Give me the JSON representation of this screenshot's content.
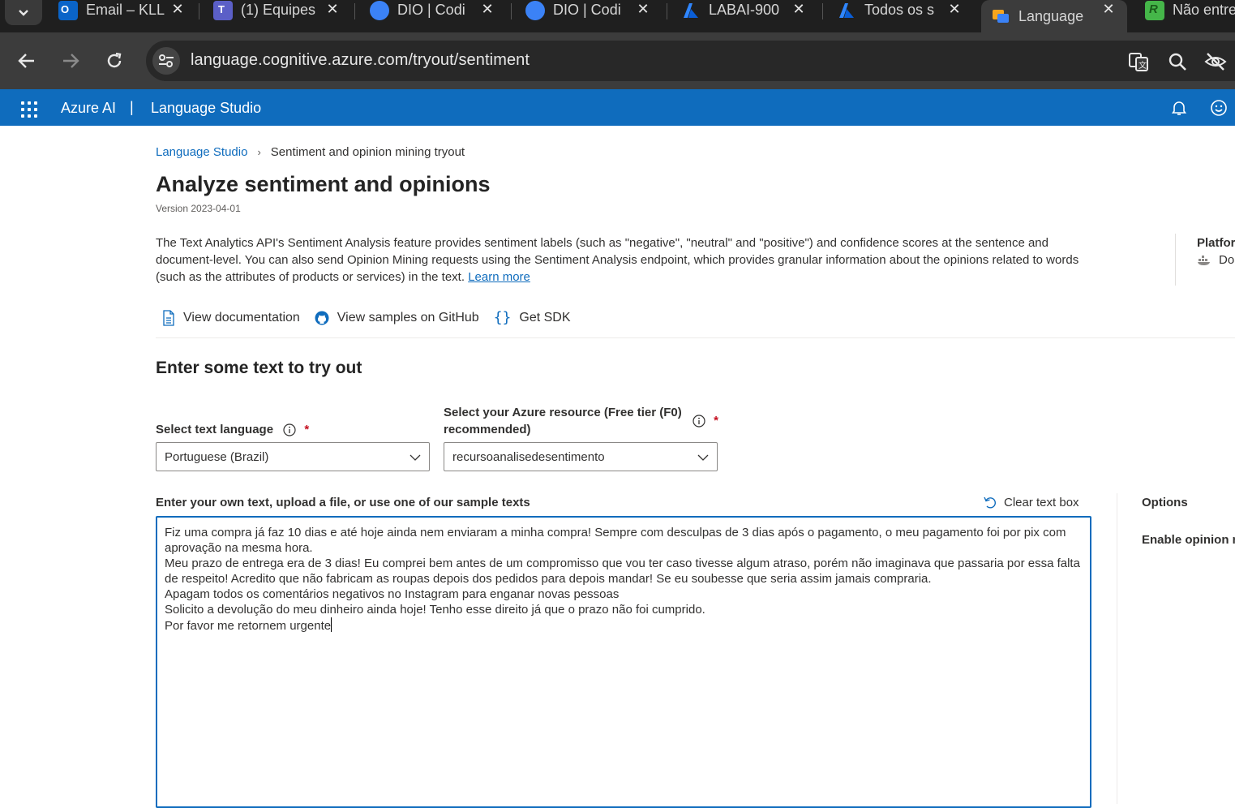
{
  "browser": {
    "tabs": [
      {
        "label": "Email – KLL",
        "favicon": "outlook-icon",
        "color": "#0078d4"
      },
      {
        "label": "(1) Equipes",
        "favicon": "teams-icon",
        "color": "#5b5fc7"
      },
      {
        "label": "DIO | Codi",
        "favicon": "dio-icon",
        "color": "#3b82f6"
      },
      {
        "label": "DIO | Codi",
        "favicon": "dio-icon",
        "color": "#3b82f6"
      },
      {
        "label": "LABAI-900",
        "favicon": "azure-icon",
        "color": "#0a7cff"
      },
      {
        "label": "Todos os s",
        "favicon": "azure-icon",
        "color": "#0a7cff"
      },
      {
        "label": "Language",
        "favicon": "language-studio-icon",
        "color": "#f7a51c"
      },
      {
        "label": "Não entre",
        "favicon": "rocketseat-icon",
        "color": "#45b649"
      }
    ],
    "close_glyph": "✕",
    "url": "language.cognitive.azure.com/tryout/sentiment"
  },
  "header": {
    "product": "Azure AI",
    "pipe": "|",
    "app": "Language Studio"
  },
  "breadcrumb": {
    "root": "Language Studio",
    "separator": "›",
    "current": "Sentiment and opinion mining tryout"
  },
  "page": {
    "title": "Analyze sentiment and opinions",
    "version": "Version 2023-04-01",
    "description": "The Text Analytics API's Sentiment Analysis feature provides sentiment labels (such as \"negative\", \"neutral\" and \"positive\") and confidence scores at the sentence and document-level. You can also send Opinion Mining requests using the Sentiment Analysis endpoint, which provides granular information about the opinions related to words (such as the attributes of products or services) in the text.",
    "learn_more": "Learn more",
    "platform_label": "Platfor",
    "platform_value": "Do"
  },
  "links": {
    "documentation": "View documentation",
    "github": "View samples on GitHub",
    "sdk": "Get SDK"
  },
  "tryout": {
    "heading": "Enter some text to try out",
    "language_label": "Select text language",
    "language_value": "Portuguese (Brazil)",
    "resource_label_line1": "Select your Azure resource (Free tier (F0)",
    "resource_label_line2": "recommended)",
    "resource_value": "recursoanalisedesentimento",
    "required_mark": "*",
    "textbox_label": "Enter your own text, upload a file, or use one of our sample texts",
    "clear_label": "Clear text box",
    "text_lines": [
      "Fiz uma compra já faz 10 dias e até hoje ainda nem enviaram a minha compra! Sempre com desculpas de 3 dias após o pagamento, o meu pagamento foi por pix com aprovação na mesma hora.",
      "Meu prazo de entrega era de 3 dias! Eu comprei bem antes de um compromisso que vou ter caso tivesse algum atraso, porém não imaginava que passaria por essa falta de respeito! Acredito que não fabricam as roupas depois dos pedidos para depois mandar! Se eu soubesse que seria assim jamais compraria.",
      "Apagam todos os comentários negativos no Instagram para enganar novas pessoas",
      "Solicito a devolução do meu dinheiro ainda hoje! Tenho esse direito já que o prazo não foi cumprido.",
      "Por favor me retornem urgente"
    ]
  },
  "options": {
    "heading": "Options",
    "opinion_label": "Enable opinion m"
  }
}
